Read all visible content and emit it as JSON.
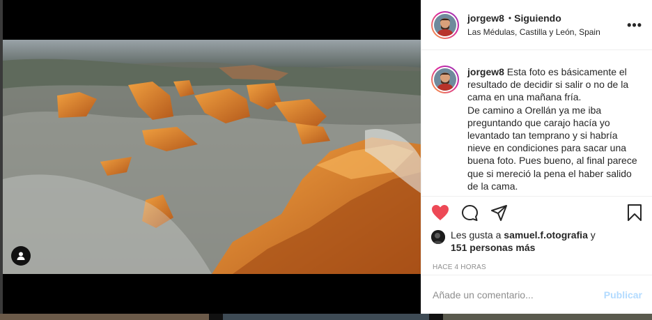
{
  "post": {
    "username": "jorgew8",
    "separator": "•",
    "follow_status": "Siguiendo",
    "location": "Las Médulas, Castilla y León, Spain",
    "more_label": "•••"
  },
  "caption": {
    "username": "jorgew8",
    "text_line1": "Esta foto es básicamente el resultado de decidir si salir o no de la cama en una mañana fría.",
    "text_line2": "De camino a Orellán ya me iba preguntando que carajo hacía yo levantado tan temprano y si habría nieve en condiciones para sacar una buena foto. Pues bueno, al final parece que si mereció la pena el haber salido de la cama."
  },
  "actions": {
    "like_icon": "heart-filled-icon",
    "comment_icon": "comment-icon",
    "share_icon": "paper-plane-icon",
    "save_icon": "bookmark-icon",
    "like_color": "#ed4956"
  },
  "likes": {
    "prefix": "Les gusta a",
    "liker": "samuel.f.otografia",
    "conjunction": "y",
    "others": "151 personas más"
  },
  "timestamp": "Hace 4 horas",
  "comment": {
    "placeholder": "Añade un comentario...",
    "publish_label": "Publicar",
    "publish_color": "#b3dbff"
  }
}
